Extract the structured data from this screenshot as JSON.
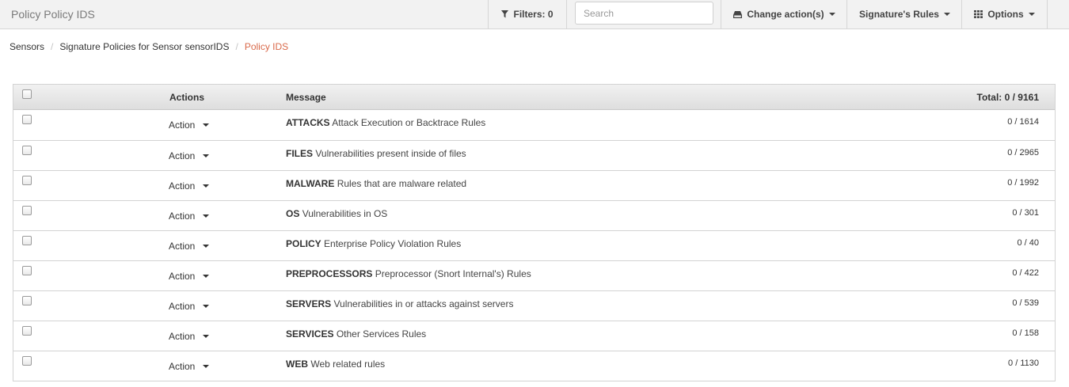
{
  "app": {
    "title": "Policy Policy IDS"
  },
  "toolbar": {
    "filters_label": "Filters: 0",
    "search_placeholder": "Search",
    "change_actions_label": "Change action(s)",
    "signature_rules_label": "Signature's Rules",
    "options_label": "Options"
  },
  "icons": {
    "filter": "filter-icon",
    "change_actions": "hdd-icon",
    "options": "grid-icon",
    "caret": "caret-down-icon"
  },
  "breadcrumb": [
    {
      "label": "Sensors"
    },
    {
      "label": "Signature Policies for Sensor sensorIDS"
    },
    {
      "label": "Policy IDS"
    }
  ],
  "colors": {
    "active_crumb": "#d9694a"
  },
  "table": {
    "headers": {
      "actions": "Actions",
      "message": "Message",
      "total": "Total: 0 / 9161"
    },
    "rows": [
      {
        "action": "Action",
        "category": "ATTACKS",
        "description": "Attack Execution or Backtrace Rules",
        "count": "0 / 1614"
      },
      {
        "action": "Action",
        "category": "FILES",
        "description": "Vulnerabilities present inside of files",
        "count": "0 / 2965"
      },
      {
        "action": "Action",
        "category": "MALWARE",
        "description": "Rules that are malware related",
        "count": "0 / 1992"
      },
      {
        "action": "Action",
        "category": "OS",
        "description": "Vulnerabilities in OS",
        "count": "0 / 301"
      },
      {
        "action": "Action",
        "category": "POLICY",
        "description": "Enterprise Policy Violation Rules",
        "count": "0 / 40"
      },
      {
        "action": "Action",
        "category": "PREPROCESSORS",
        "description": "Preprocessor (Snort Internal's) Rules",
        "count": "0 / 422"
      },
      {
        "action": "Action",
        "category": "SERVERS",
        "description": "Vulnerabilities in or attacks against servers",
        "count": "0 / 539"
      },
      {
        "action": "Action",
        "category": "SERVICES",
        "description": "Other Services Rules",
        "count": "0 / 158"
      },
      {
        "action": "Action",
        "category": "WEB",
        "description": "Web related rules",
        "count": "0 / 1130"
      }
    ]
  }
}
